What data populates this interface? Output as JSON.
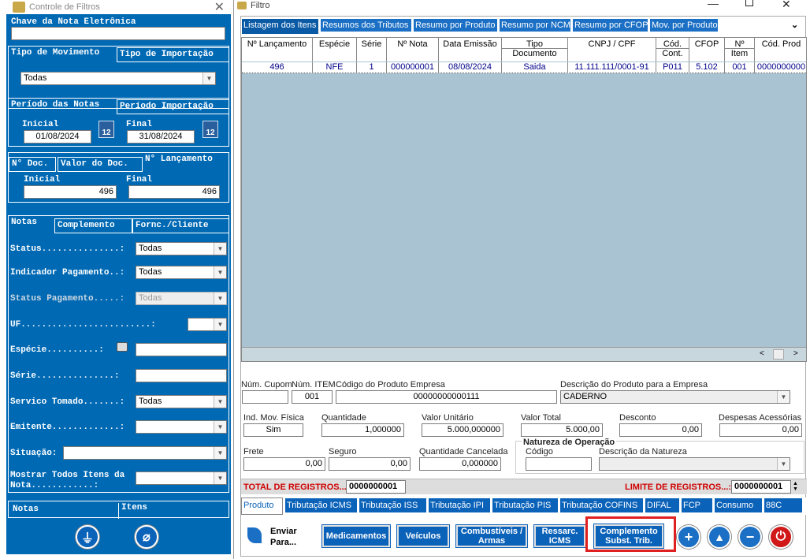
{
  "left": {
    "title": "Controle de Filtros",
    "chave_label": "Chave da Nota Eletrônica",
    "chave_value": "",
    "tipo_mov_tab": "Tipo de Movimento",
    "tipo_imp_tab": "Tipo de Importação",
    "tipo_value": "Todas",
    "periodo_notas_tab": "Período das Notas",
    "periodo_imp_tab": "Período Importação",
    "inicial_label": "Inicial",
    "final_label": "Final",
    "data_inicial": "01/08/2024",
    "data_final": "31/08/2024",
    "cal_day": "12",
    "ndoc_tab": "N° Doc.",
    "valor_doc_tab": "Valor do Doc.",
    "nlanc_tab": "N° Lançamento",
    "lanc_inicial": "496",
    "lanc_final": "496",
    "notas_tab": "Notas",
    "complemento_tab": "Complemento",
    "fornc_tab": "Fornc./Cliente",
    "fields": [
      {
        "label": "Status...............:",
        "value": "Todas"
      },
      {
        "label": "Indicador Pagamento..:",
        "value": "Todas"
      },
      {
        "label": "Status Pagamento.....:",
        "value": "Todas"
      },
      {
        "label": "UF.........................:",
        "value": ""
      },
      {
        "label": "Espécie..........:",
        "value": ""
      },
      {
        "label": "Série...............:",
        "value": ""
      },
      {
        "label": "Servico Tomado.......:",
        "value": "Todas"
      },
      {
        "label": "Emitente.............:",
        "value": ""
      },
      {
        "label": "Situação:",
        "value": ""
      },
      {
        "label": "Mostrar Todos Itens da Nota............:",
        "value": ""
      }
    ],
    "bottom_tab_notas": "Notas",
    "bottom_tab_itens": "Itens"
  },
  "right": {
    "title": "Filtro",
    "tabs": [
      "Listagem dos Itens",
      "Resumos dos Tributos",
      "Resumo por Produto",
      "Resumo por NCM",
      "Resumo por CFOP",
      "Mov. por Produto"
    ],
    "columns": [
      {
        "h1": "Nº Lançamento",
        "h2": ""
      },
      {
        "h1": "Espécie",
        "h2": ""
      },
      {
        "h1": "Série",
        "h2": ""
      },
      {
        "h1": "Nº Nota",
        "h2": ""
      },
      {
        "h1": "Data Emissão",
        "h2": ""
      },
      {
        "h1": "Tipo",
        "h2": "Documento"
      },
      {
        "h1": "CNPJ / CPF",
        "h2": ""
      },
      {
        "h1": "Cód.",
        "h2": "Cont."
      },
      {
        "h1": "CFOP",
        "h2": ""
      },
      {
        "h1": "Nº",
        "h2": "Item"
      },
      {
        "h1": "Cód. Prod",
        "h2": ""
      }
    ],
    "rows": [
      [
        "496",
        "NFE",
        "1",
        "000000001",
        "08/08/2024",
        "Saida",
        "11.111.111/0001-91",
        "P011",
        "5.102",
        "001",
        "0000000000"
      ]
    ],
    "detail": {
      "num_cupom_label": "Núm. Cupom",
      "num_item_label": "Núm. ITEM",
      "num_cupom": "",
      "num_item": "001",
      "cod_prod_label": "Código do Produto Empresa",
      "cod_prod": "00000000000111",
      "desc_prod_label": "Descrição do Produto para a Empresa",
      "desc_prod": "CADERNO",
      "ind_mov_label": "Ind. Mov. Física",
      "ind_mov": "Sim",
      "qtd_label": "Quantidade",
      "qtd": "1,000000",
      "vunit_label": "Valor Unitário",
      "vunit": "5.000,000000",
      "vtotal_label": "Valor Total",
      "vtotal": "5.000,00",
      "desconto_label": "Desconto",
      "desconto": "0,00",
      "desp_label": "Despesas Acessórias",
      "desp": "0,00",
      "frete_label": "Frete",
      "frete": "0,00",
      "seguro_label": "Seguro",
      "seguro": "0,00",
      "qtd_canc_label": "Quantidade Cancelada",
      "qtd_canc": "0,000000",
      "natureza_label": "Natureza de Operação",
      "codigo_label": "Código",
      "codigo": "",
      "desc_nat_label": "Descrição da Natureza",
      "desc_nat": ""
    },
    "total_label": "TOTAL DE REGISTROS...:",
    "total_value": "0000000001",
    "limite_label": "LIMITE DE REGISTROS...:",
    "limite_value": "0000000001",
    "bottom_tabs": [
      "Produto",
      "Tributação ICMS",
      "Tributação ISS",
      "Tributação IPI",
      "Tributação PIS",
      "Tributação COFINS",
      "DIFAL",
      "FCP",
      "Consumo",
      "88C"
    ],
    "enviar": "Enviar Para...",
    "buttons": {
      "medicamentos": "Medicamentos",
      "veiculos": "Veículos",
      "combustiveis": "Combustíveis / Armas",
      "ressarc": "Ressarc. ICMS",
      "complemento": "Complemento Subst. Trib."
    },
    "highlight_color": "#e02020"
  }
}
